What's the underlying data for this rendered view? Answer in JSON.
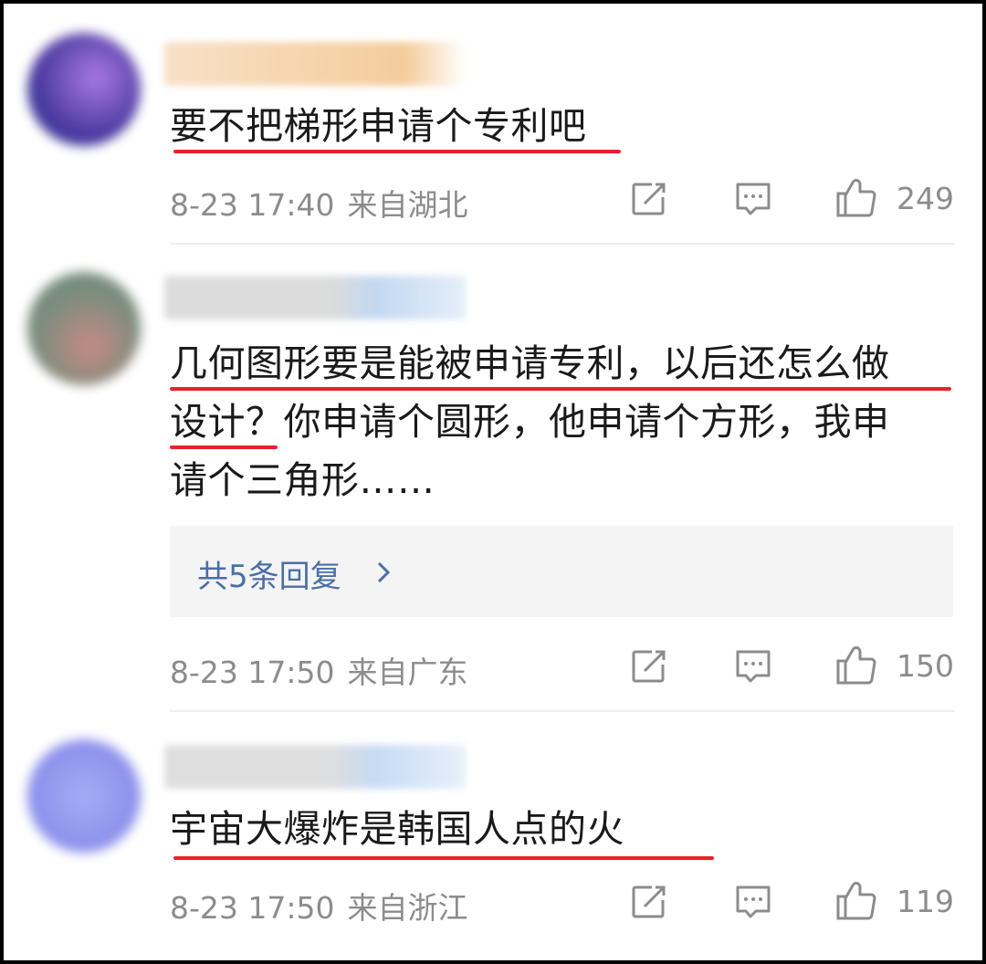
{
  "comments": [
    {
      "text": "要不把梯形申请个专利吧",
      "time": "8-23 17:40",
      "location": "来自湖北",
      "likes": "249",
      "avatar_colors": [
        "#3b2a8f",
        "#9a6fd6"
      ],
      "name_colors": [
        "#f6d6b4",
        "#f2c89a"
      ]
    },
    {
      "text_lines": [
        "几何图形要是能被申请专利，以后还怎么做",
        "设计？你申请个圆形，他申请个方形，我申",
        "请个三角形……"
      ],
      "time": "8-23 17:50",
      "location": "来自广东",
      "likes": "150",
      "replies_label": "共5条回复",
      "avatar_colors": [
        "#6c8c7a",
        "#c08a86"
      ],
      "name_colors": [
        "#d6d6d6",
        "#bcd4f0"
      ]
    },
    {
      "text": "宇宙大爆炸是韩国人点的火",
      "time": "8-23 17:50",
      "location": "来自浙江",
      "likes": "119",
      "avatar_colors": [
        "#8e92ee",
        "#aab0f4"
      ],
      "name_colors": [
        "#dcdcdc",
        "#c8dcf4"
      ]
    }
  ],
  "icons": {
    "repost": "repost-icon",
    "comment": "comment-icon",
    "like": "thumbs-up-icon",
    "chevron": "chevron-right-icon"
  },
  "colors": {
    "underline": "#e8222b",
    "meta": "#8c8c8c",
    "reply_link": "#4a6fa5"
  }
}
